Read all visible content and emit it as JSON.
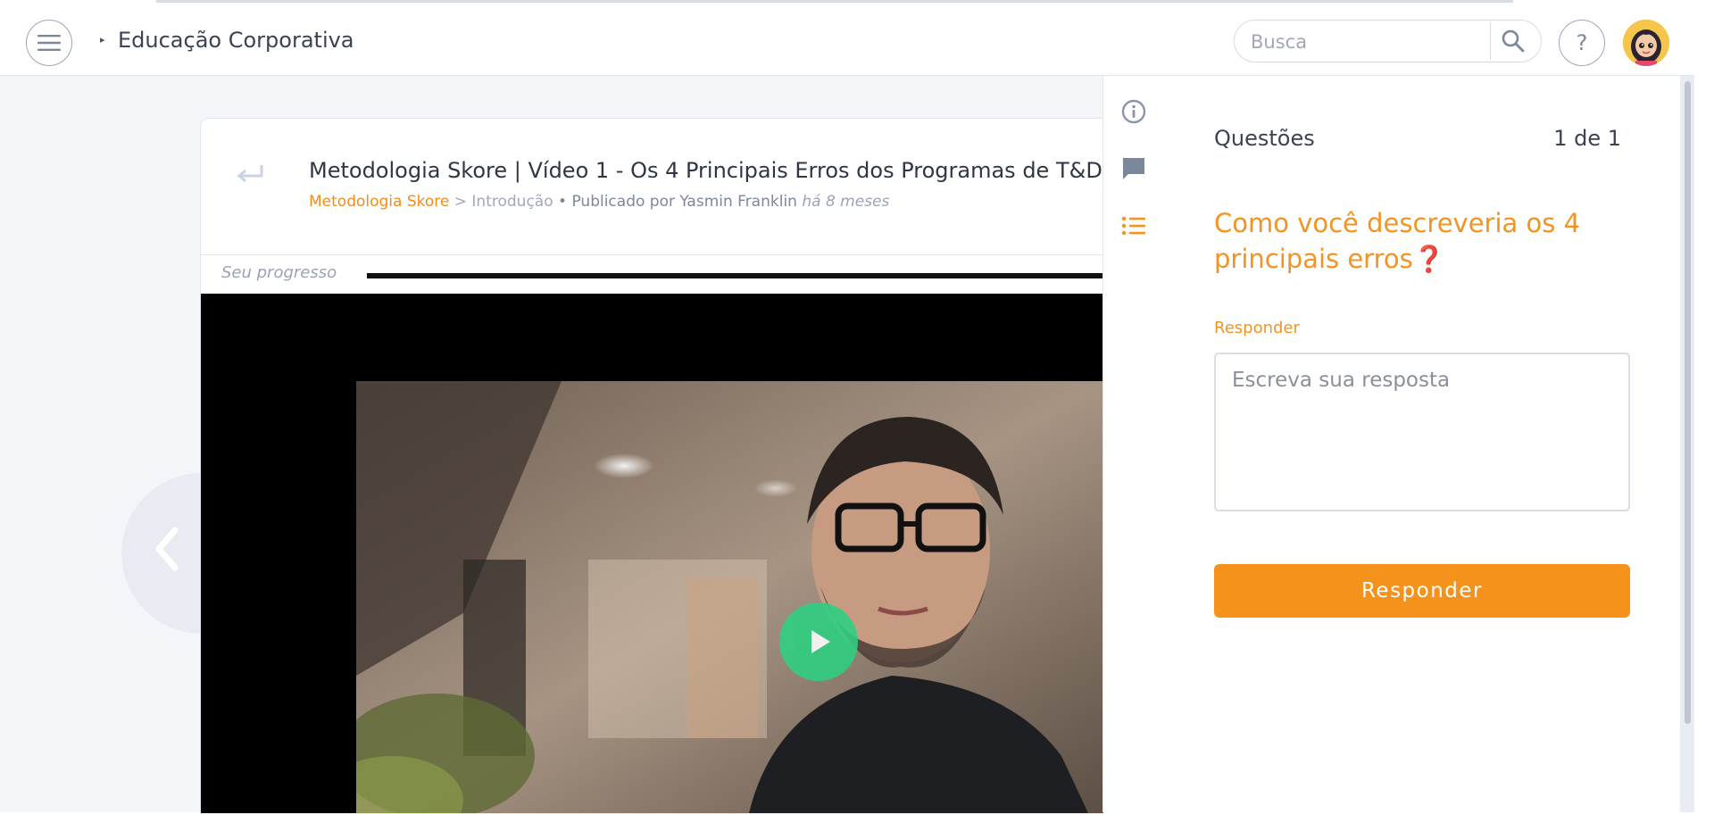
{
  "header": {
    "app_title": "Educação Corporativa",
    "search_placeholder": "Busca",
    "help_label": "?"
  },
  "lesson": {
    "title": "Metodologia Skore | Vídeo 1 - Os 4 Principais Erros dos Programas de T&D",
    "course": "Metodologia Skore",
    "separator": ">",
    "module": "Introdução",
    "published_by": "• Publicado por Yasmin Franklin",
    "published_when": "há 8 meses",
    "progress_label": "Seu progresso",
    "progress_fraction": 1.0
  },
  "panel": {
    "label": "Questões",
    "count": "1 de 1",
    "question": "Como você descreveria os 4 principais erros❓",
    "answer_label": "Responder",
    "answer_placeholder": "Escreva sua resposta",
    "submit_label": "Responder"
  },
  "icons": {
    "menu": "hamburger-icon",
    "search": "search-icon",
    "help": "question-icon",
    "back": "return-arrow-icon",
    "prev": "chevron-left-icon",
    "play": "play-icon",
    "info": "info-icon",
    "comments": "comment-icon",
    "list": "list-icon"
  },
  "colors": {
    "accent": "#f5921b",
    "play": "#2dd182",
    "background": "#f3f5f9"
  }
}
